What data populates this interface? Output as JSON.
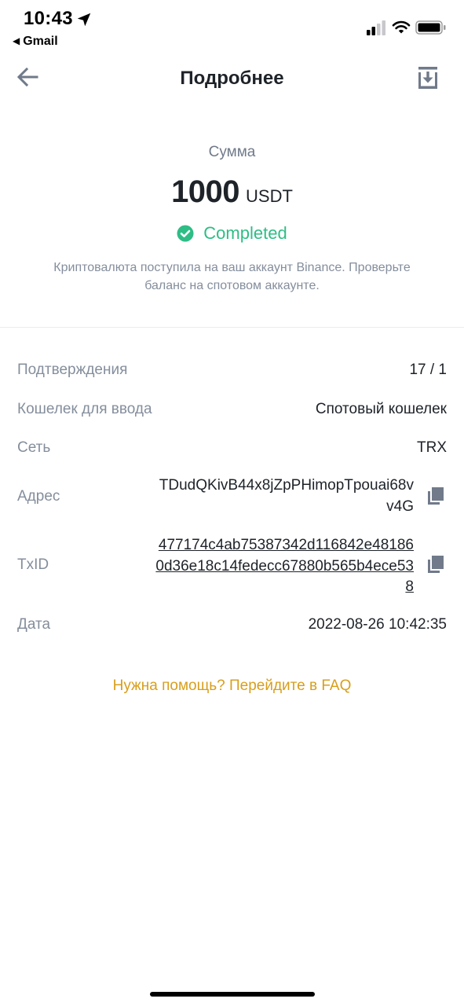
{
  "status_bar": {
    "time": "10:43",
    "back_app": "Gmail",
    "location_icon": "location-arrow-icon",
    "signal_icon": "cellular-signal-icon",
    "wifi_icon": "wifi-icon",
    "battery_icon": "battery-icon"
  },
  "header": {
    "title": "Подробнее",
    "back_icon": "arrow-left-icon",
    "download_icon": "download-icon"
  },
  "amount": {
    "label": "Сумма",
    "value": "1000",
    "unit": "USDT",
    "status": "Completed",
    "status_color": "#2ebd85",
    "info": "Криптовалюта поступила на ваш аккаунт Binance. Проверьте баланс на спотовом аккаунте."
  },
  "details": {
    "confirmations": {
      "label": "Подтверждения",
      "value": "17 / 1"
    },
    "wallet": {
      "label": "Кошелек для ввода",
      "value": "Спотовый кошелек"
    },
    "network": {
      "label": "Сеть",
      "value": "TRX"
    },
    "address": {
      "label": "Адрес",
      "value": "TDudQKivB44x8jZpPHimopTpouai68vv4G"
    },
    "txid": {
      "label": "TxID",
      "value": "477174c4ab75387342d116842e481860d36e18c14fedecc67880b565b4ece538"
    },
    "date": {
      "label": "Дата",
      "value": "2022-08-26 10:42:35"
    }
  },
  "faq_link": "Нужна помощь? Перейдите в FAQ",
  "colors": {
    "accent": "#d89e1b",
    "success": "#2ebd85",
    "muted": "#848e9c",
    "text": "#1e2329"
  }
}
